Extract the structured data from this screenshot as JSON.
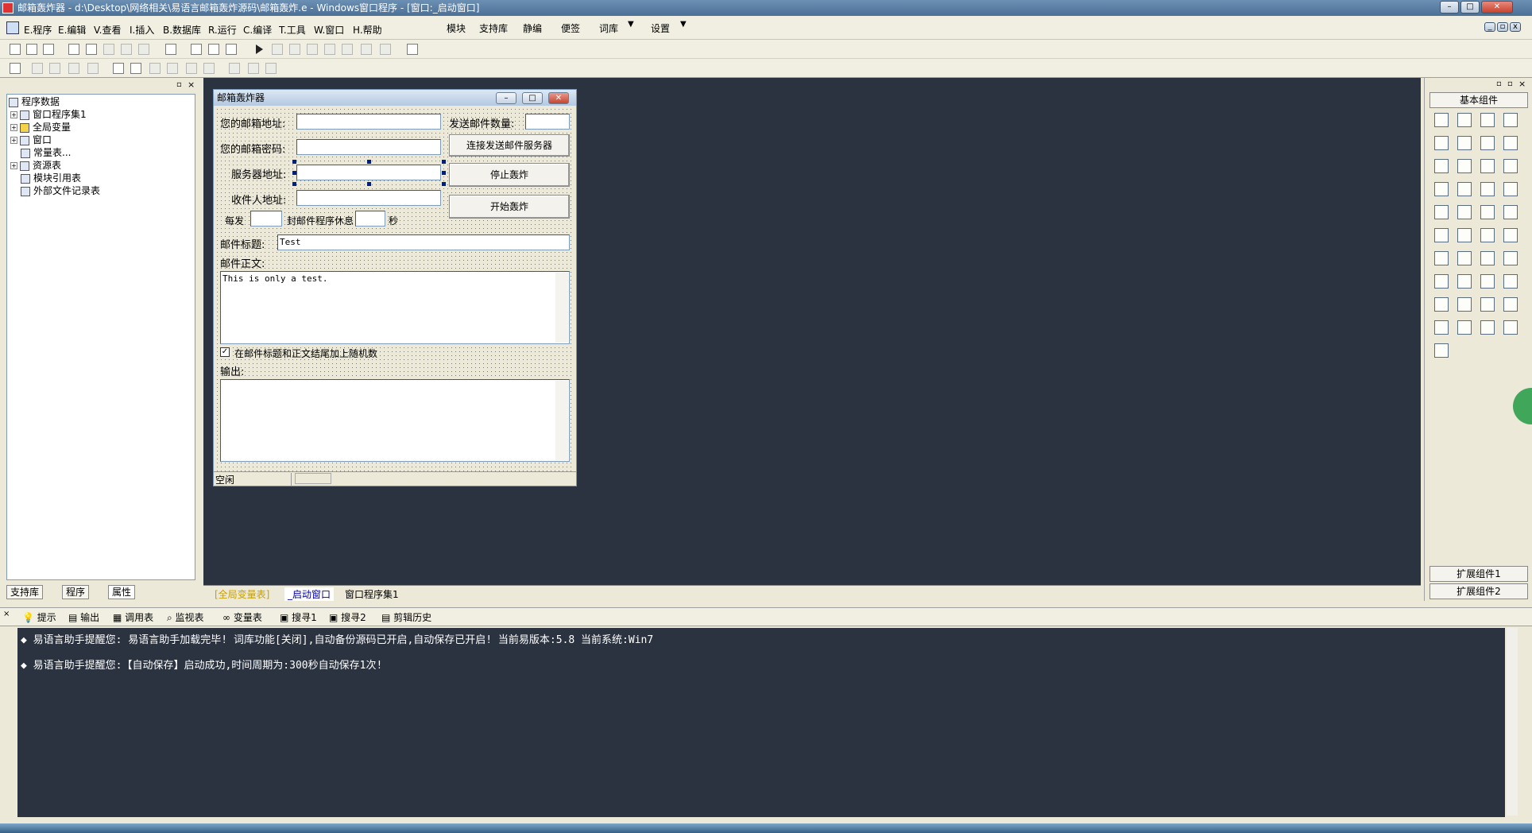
{
  "window": {
    "title": "邮箱轰炸器 - d:\\Desktop\\网络相关\\易语言邮箱轰炸源码\\邮箱轰炸.e - Windows窗口程序 - [窗口:_启动窗口]"
  },
  "menu": {
    "items": [
      "E.程序",
      "E.编辑",
      "V.查看",
      "I.插入",
      "B.数据库",
      "R.运行",
      "C.编译",
      "T.工具",
      "W.窗口",
      "H.帮助"
    ],
    "extras": [
      "模块",
      "支持库",
      "静编",
      "便签",
      "词库",
      "设置"
    ]
  },
  "tree": {
    "items": [
      "程序数据",
      "窗口程序集1",
      "全局变量",
      "窗口",
      "常量表...",
      "资源表",
      "模块引用表",
      "外部文件记录表"
    ]
  },
  "left_tabs": [
    "支持库",
    "程序",
    "属性"
  ],
  "form": {
    "title": "邮箱轰炸器",
    "email_label": "您的邮箱地址:",
    "password_label": "您的邮箱密码:",
    "server_label": "服务器地址:",
    "recipient_label": "收件人地址:",
    "send_count_label": "发送邮件数量:",
    "connect_button": "连接发送邮件服务器",
    "stop_button": "停止轰炸",
    "start_button": "开始轰炸",
    "every_label": "每发",
    "rest_label": "封邮件程序休息",
    "seconds_label": "秒",
    "subject_label": "邮件标题:",
    "subject_value": "Test",
    "body_label": "邮件正文:",
    "body_value": "This is only a test.",
    "random_checkbox_label": "在邮件标题和正文结尾加上随机数",
    "random_checked": true,
    "output_label": "输出:",
    "status_text": "空闲"
  },
  "right_panel": {
    "title": "基本组件",
    "ext1": "扩展组件1",
    "ext2": "扩展组件2"
  },
  "editor_tabs": [
    "[全局变量表]",
    "_启动窗口",
    "窗口程序集1"
  ],
  "bottom_tabs": [
    "提示",
    "输出",
    "调用表",
    "监视表",
    "变量表",
    "搜寻1",
    "搜寻2",
    "剪辑历史"
  ],
  "output_lines": [
    "易语言助手提醒您: 易语言助手加载完毕! 词库功能[关闭],自动备份源码已开启,自动保存已开启! 当前易版本:5.8 当前系统:Win7",
    "易语言助手提醒您:【自动保存】启动成功,时间周期为:300秒自动保存1次!"
  ]
}
